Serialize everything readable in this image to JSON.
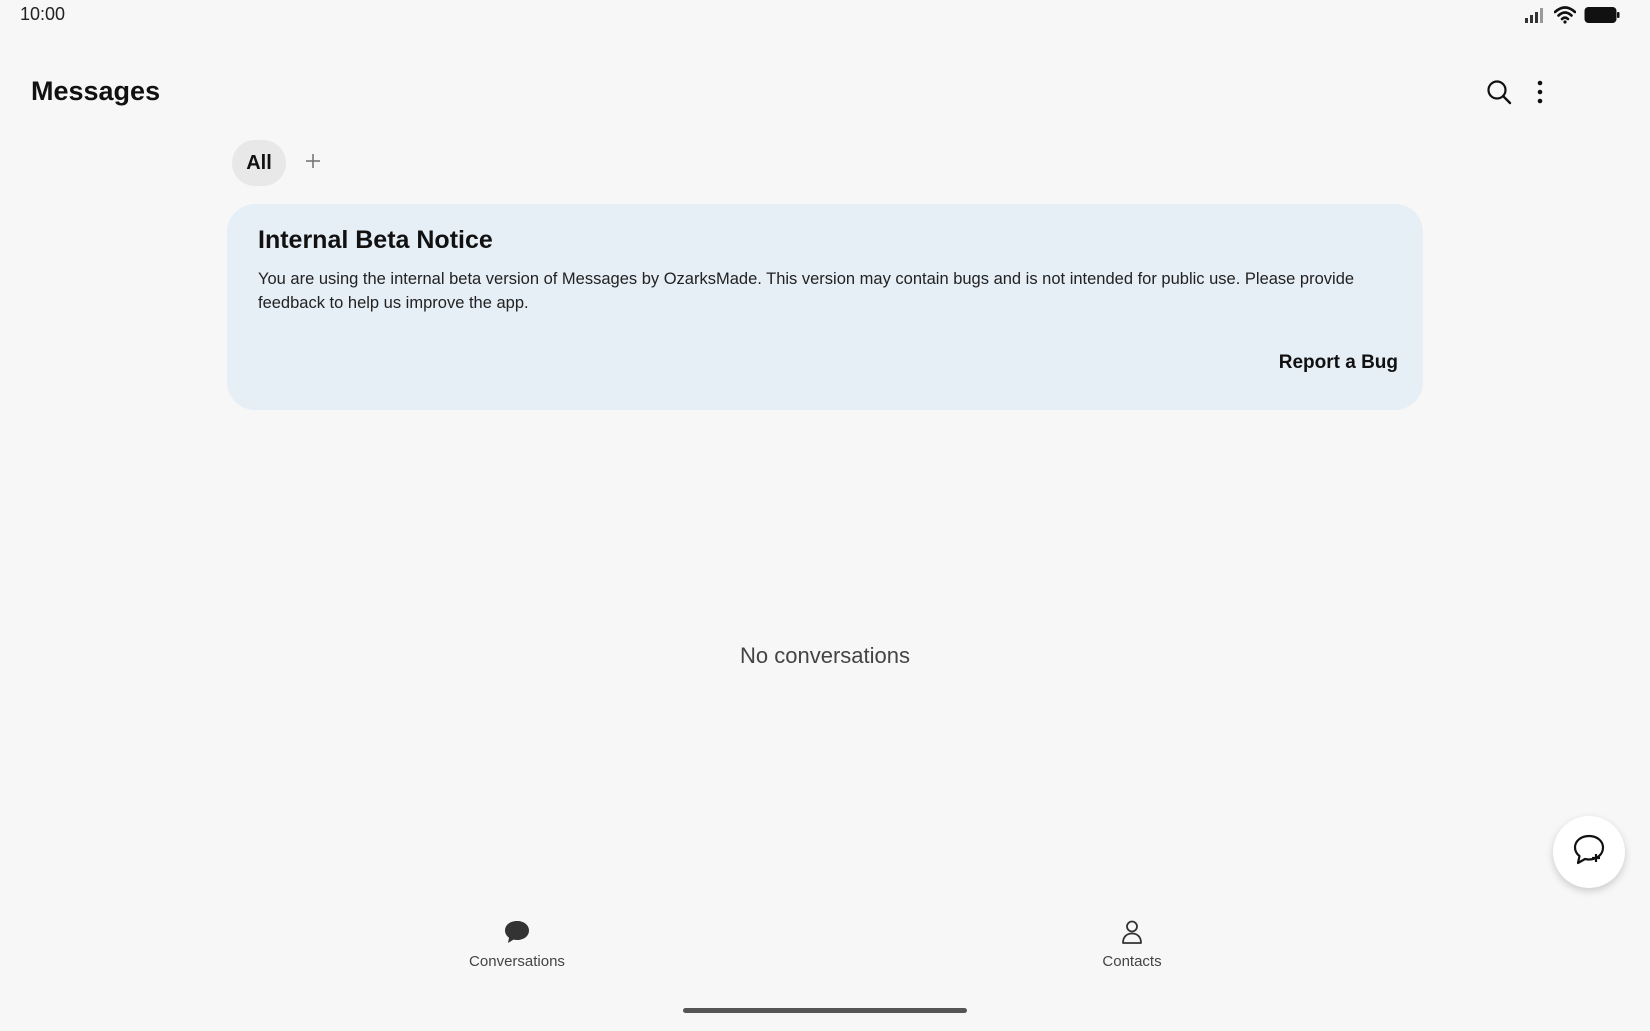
{
  "status_bar": {
    "time": "10:00"
  },
  "header": {
    "title": "Messages",
    "search_icon": "search-icon",
    "more_icon": "more-vertical-icon"
  },
  "tabs": {
    "all_label": "All",
    "add_icon": "plus-icon"
  },
  "notice": {
    "title": "Internal Beta Notice",
    "body": "You are using the internal beta version of Messages by OzarksMade. This version may contain bugs and is not intended for public use. Please provide feedback to help us improve the app.",
    "action_label": "Report a Bug"
  },
  "empty_state": {
    "text": "No conversations"
  },
  "fab": {
    "icon": "new-chat-icon"
  },
  "bottom_nav": {
    "items": [
      {
        "label": "Conversations",
        "icon": "chat-bubble-icon"
      },
      {
        "label": "Contacts",
        "icon": "person-icon"
      }
    ]
  },
  "colors": {
    "background": "#f7f7f7",
    "card": "#e6eef6",
    "tab_selected": "#e8e8e8"
  }
}
